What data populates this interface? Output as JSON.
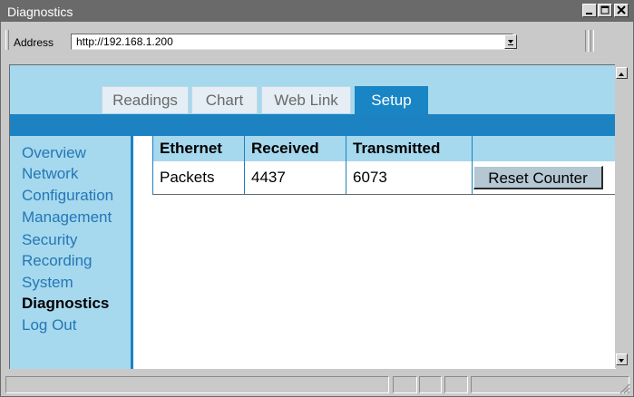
{
  "window": {
    "title": "Diagnostics"
  },
  "address_bar": {
    "label": "Address",
    "url": "http://192.168.1.200"
  },
  "tabs": [
    {
      "label": "Readings",
      "active": false
    },
    {
      "label": "Chart",
      "active": false
    },
    {
      "label": "Web Link",
      "active": false
    },
    {
      "label": "Setup",
      "active": true
    }
  ],
  "sidebar": {
    "items": [
      {
        "label": "Overview"
      },
      {
        "label": "Network"
      },
      {
        "label": "Configuration"
      },
      {
        "label": "Management"
      },
      {
        "label": "Security"
      },
      {
        "label": "Recording"
      },
      {
        "label": "System"
      },
      {
        "label": "Diagnostics",
        "active": true
      },
      {
        "label": "Log Out"
      }
    ]
  },
  "table": {
    "headers": [
      "Ethernet",
      "Received",
      "Transmitted",
      ""
    ],
    "row": {
      "label": "Packets",
      "received": "4437",
      "transmitted": "6073"
    },
    "reset_label": "Reset Counter"
  },
  "colors": {
    "title_bar": "#6a6a6a",
    "light_blue": "#a6d8ee",
    "dark_blue": "#1c82c2",
    "nav_text": "#2477b5"
  }
}
